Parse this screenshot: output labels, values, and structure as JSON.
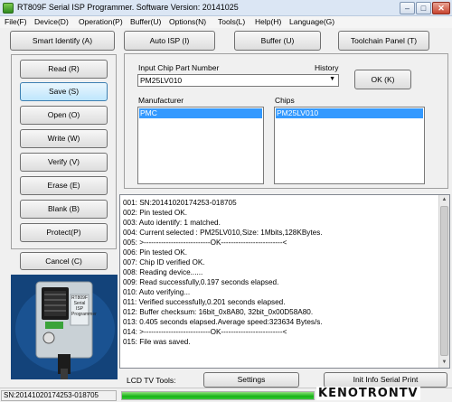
{
  "window": {
    "title": "RT809F Serial ISP Programmer. Software Version: 20141025",
    "minimize": "–",
    "maximize": "□",
    "close": "✕"
  },
  "menu": [
    "File(F)",
    "Device(D)",
    "Operation(P)",
    "Buffer(U)",
    "Options(N)",
    "Tools(L)",
    "Help(H)",
    "Language(G)"
  ],
  "toolbar": {
    "smart_identify": "Smart Identify (A)",
    "auto_isp": "Auto ISP (I)",
    "buffer": "Buffer (U)",
    "toolchain": "Toolchain Panel (T)"
  },
  "side_buttons": [
    "Read (R)",
    "Save (S)",
    "Open (O)",
    "Write  (W)",
    "Verify (V)",
    "Erase (E)",
    "Blank (B)",
    "Protect(P)"
  ],
  "active_side_button": 1,
  "cancel": "Cancel (C)",
  "chip": {
    "input_label": "Input Chip Part Number",
    "history_label": "History",
    "value": "PM25LV010",
    "ok": "OK (K)",
    "manufacturer_label": "Manufacturer",
    "manufacturer_selected": "PMC",
    "chips_label": "Chips",
    "chips_selected": "PM25LV010"
  },
  "log": [
    "001:  SN:20141020174253-018705",
    "002:  Pin tested OK.",
    "003:  Auto identify: 1 matched.",
    "004:  Current selected : PM25LV010,Size: 1Mbits,128KBytes.",
    "005:  >---------------------------OK-------------------------<",
    "006:  Pin tested OK.",
    "007:  Chip ID verified OK.",
    "008:  Reading device......",
    "009:  Read successfully,0.197 seconds elapsed.",
    "010:  Auto verifying...",
    "011:  Verified successfully,0.201 seconds elapsed.",
    "012:  Buffer checksum: 16bit_0x8A80, 32bit_0x00D58A80.",
    "013:  0.405 seconds elapsed.Average speed:323634 Bytes/s.",
    "014:  >---------------------------OK-------------------------<",
    "015:  File was saved."
  ],
  "bottom": {
    "lcd_label": "LCD TV Tools:",
    "settings": "Settings",
    "init": "Init Info Serial Print"
  },
  "status": {
    "sn": "SN:20141020174253-018705",
    "progress": 1.0
  },
  "watermark": "KENOTRONTV",
  "device": {
    "label": "RT809F Serial ISP Programmer"
  },
  "colors": {
    "selection": "#3399ff",
    "progress": "#16b416"
  }
}
